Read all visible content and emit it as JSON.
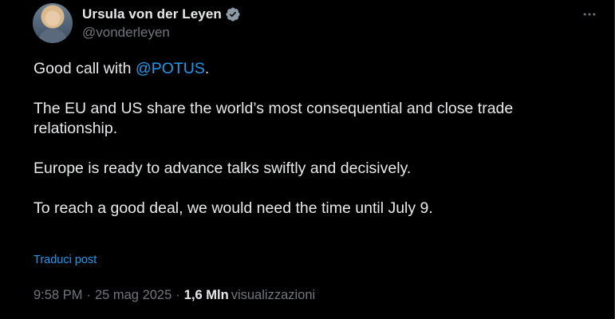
{
  "author": {
    "display_name": "Ursula von der Leyen",
    "handle": "@vonderleyen",
    "avatar_icon": "profile-photo",
    "verified_icon": "verified-badge-icon",
    "verified_color": "#8b98a5"
  },
  "more_icon": "more-options-icon",
  "tweet": {
    "line1_prefix": "Good call with ",
    "line1_mention": "@POTUS",
    "line1_suffix": ".",
    "para2": "The EU and US share the world’s most consequential and close trade relationship.",
    "para3": "Europe is ready to advance talks swiftly and decisively.",
    "para4": "To reach a good deal, we would need the time until July 9."
  },
  "translate_label": "Traduci post",
  "meta": {
    "time": "9:58 PM",
    "separator": "·",
    "date": "25 mag 2025",
    "views_count": "1,6 Mln",
    "views_label": "visualizzazioni"
  },
  "colors": {
    "background": "#000000",
    "text": "#e7e9ea",
    "secondary": "#71767b",
    "link": "#1d9bf0"
  }
}
